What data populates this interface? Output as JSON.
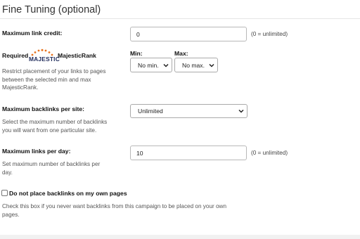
{
  "section": {
    "title": "Fine Tuning (optional)"
  },
  "max_link_credit": {
    "label": "Maximum link credit:",
    "value": "0",
    "hint": "(0 = unlimited)"
  },
  "majestic": {
    "required_label": "Required",
    "logo_text": "MAJESTIC",
    "rank_label": "MajesticRank",
    "min_label": "Min:",
    "max_label": "Max:",
    "min_value": "No min.",
    "max_value": "No max.",
    "help_lines": [
      "Restrict placement of your links to pages",
      "between the selected min and max",
      "MajesticRank."
    ]
  },
  "max_backlinks_per_site": {
    "label": "Maximum backlinks per site:",
    "value": "Unlimited",
    "help_lines": [
      "Select the maximum number of backlinks",
      "you will want from one particular site."
    ]
  },
  "max_links_per_day": {
    "label": "Maximum links per day:",
    "value": "10",
    "hint": "(0 = unlimited)",
    "help_lines": [
      "Set maximum number of backlinks per",
      "day."
    ]
  },
  "own_pages": {
    "label": "Do not place backlinks on my own pages",
    "checked": false,
    "help_lines": [
      "Check this box if you never want backlinks from this campaign to be placed on your own",
      "pages."
    ]
  },
  "colors": {
    "logo_text": "#1e2a5a",
    "logo_rays": "#e8731f"
  }
}
